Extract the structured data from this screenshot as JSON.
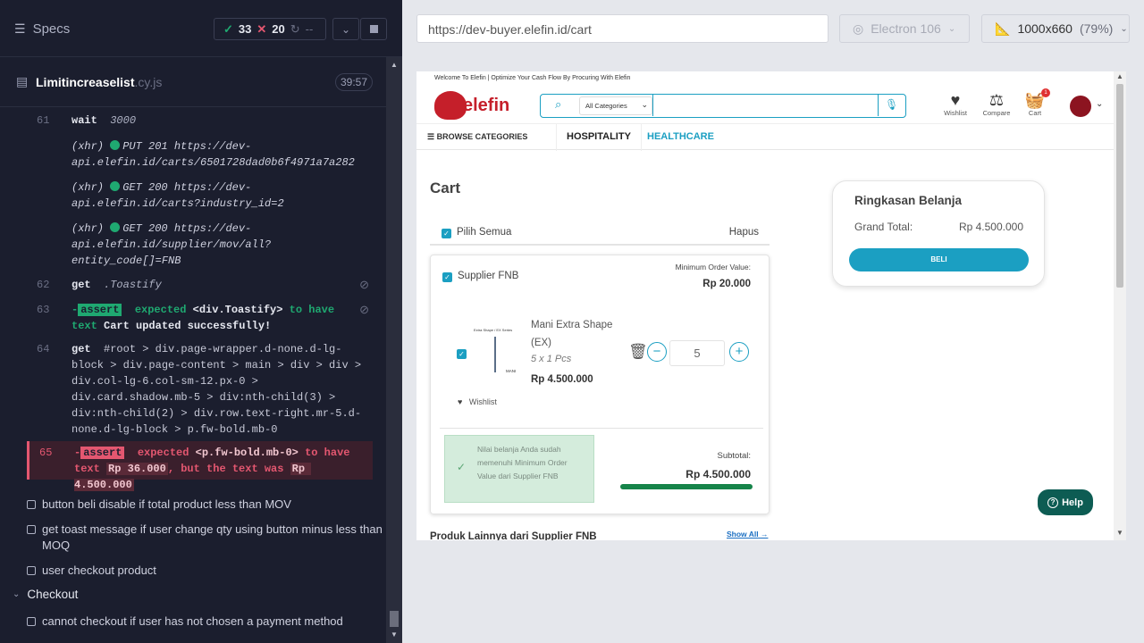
{
  "runner": {
    "specs_label": "Specs",
    "passed": "33",
    "failed": "20",
    "pending": "--",
    "file_name": "Limitincreaselist",
    "file_ext": ".cy.js",
    "duration": "39:57"
  },
  "commands": [
    {
      "num": "61",
      "name": "wait",
      "arg": "3000"
    },
    {
      "num": "",
      "xhr": "(xhr)",
      "text": "PUT 201 https://dev-api.elefin.id/carts/6501728dad0b6f4971a7a282"
    },
    {
      "num": "",
      "xhr": "(xhr)",
      "text": "GET 200 https://dev-api.elefin.id/carts?industry_id=2"
    },
    {
      "num": "",
      "xhr": "(xhr)",
      "text": "GET 200 https://dev-api.elefin.id/supplier/mov/all?entity_code[]=FNB"
    },
    {
      "num": "62",
      "name": "get",
      "arg": ".Toastify"
    },
    {
      "num": "63",
      "prefix": "-",
      "tag": "assert",
      "t1": "expected",
      "t2": "<div.Toastify>",
      "t3": "to have text",
      "t4": "Cart updated successfully!"
    },
    {
      "num": "64",
      "name": "get",
      "arg": "#root > div.page-wrapper.d-none.d-lg-block > div.page-content > main > div > div > div.col-lg-6.col-sm-12.px-0 > div.card.shadow.mb-5 > div:nth-child(3) > div:nth-child(2) > div.row.text-right.mr-5.d-none.d-lg-block > p.fw-bold.mb-0"
    },
    {
      "num": "65",
      "prefix": "-",
      "tag": "assert",
      "t1": "expected",
      "t2": "<p.fw-bold.mb-0>",
      "t3": "to have text",
      "v1": "Rp 36.000",
      "t5": ", but the text was",
      "v2": "Rp 4.500.000"
    }
  ],
  "tests": [
    "button beli disable if total product less than MOV",
    "get toast message if user change qty using button minus less than MOQ",
    "user checkout product"
  ],
  "suite": "Checkout",
  "suite_tests": [
    "cannot checkout if user has not chosen a payment method"
  ],
  "browser": {
    "url": "https://dev-buyer.elefin.id/cart",
    "engine": "Electron 106",
    "viewport": "1000x660",
    "zoom": "(79%)"
  },
  "site": {
    "welcome": "Welcome To Elefin | Optimize Your Cash Flow By Procuring With Elefin",
    "logo_text": "elefin",
    "category": "All Categories",
    "wishlist": "Wishlist",
    "compare": "Compare",
    "cart": "Cart",
    "cart_count": "1",
    "browse": "BROWSE CATEGORIES",
    "nav1": "HOSPITALITY",
    "nav2": "HEALTHCARE",
    "page_title": "Cart",
    "select_all": "Pilih Semua",
    "delete": "Hapus",
    "supplier": "Supplier FNB",
    "mov_label": "Minimum Order Value:",
    "mov_value": "Rp 20.000",
    "product_name": "Mani Extra Shape (EX)",
    "product_pack": "5 x 1 Pcs",
    "product_price": "Rp 4.500.000",
    "product_img_text": "Extra Shape / EX Series",
    "product_img_brand": "MANI",
    "qty": "5",
    "wishlist_link": "Wishlist",
    "notice": "Nilai belanja Anda sudah memenuhi Minimum Order Value dari Supplier FNB",
    "subtotal_label": "Subtotal:",
    "subtotal_value": "Rp 4.500.000",
    "progress": 1.0,
    "more_title": "Produk Lainnya dari Supplier FNB",
    "show_all": "Show All",
    "summary_title": "Ringkasan Belanja",
    "grand_total_label": "Grand Total:",
    "grand_total_value": "Rp 4.500.000",
    "buy": "BELI",
    "help": "Help"
  }
}
